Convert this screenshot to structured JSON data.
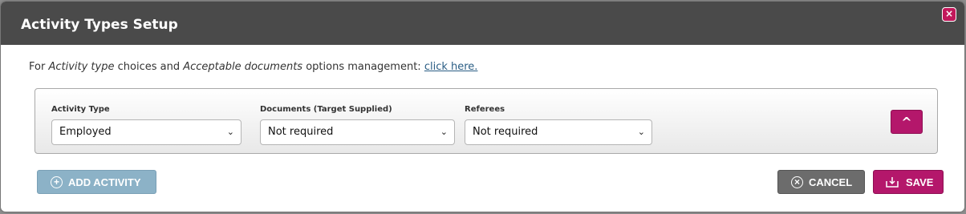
{
  "modal": {
    "title": "Activity Types Setup",
    "close_label": "×"
  },
  "info": {
    "prefix": "For ",
    "activity_type_em": "Activity type",
    "middle": " choices and ",
    "acceptable_docs_em": "Acceptable documents",
    "suffix": " options management: ",
    "link_text": "click here."
  },
  "activity": {
    "activity_type_label": "Activity Type",
    "activity_type_value": "Employed",
    "documents_label": "Documents (Target Supplied)",
    "documents_value": "Not required",
    "referees_label": "Referees",
    "referees_value": "Not required",
    "collapse_label": "^"
  },
  "buttons": {
    "add_activity": "ADD ACTIVITY",
    "cancel": "CANCEL",
    "save": "SAVE"
  },
  "colors": {
    "header_bg": "#4a4a4a",
    "accent": "#b4176b",
    "add_button": "#8cb2c7",
    "cancel_button": "#6c6c6c",
    "link": "#2a5d84"
  }
}
